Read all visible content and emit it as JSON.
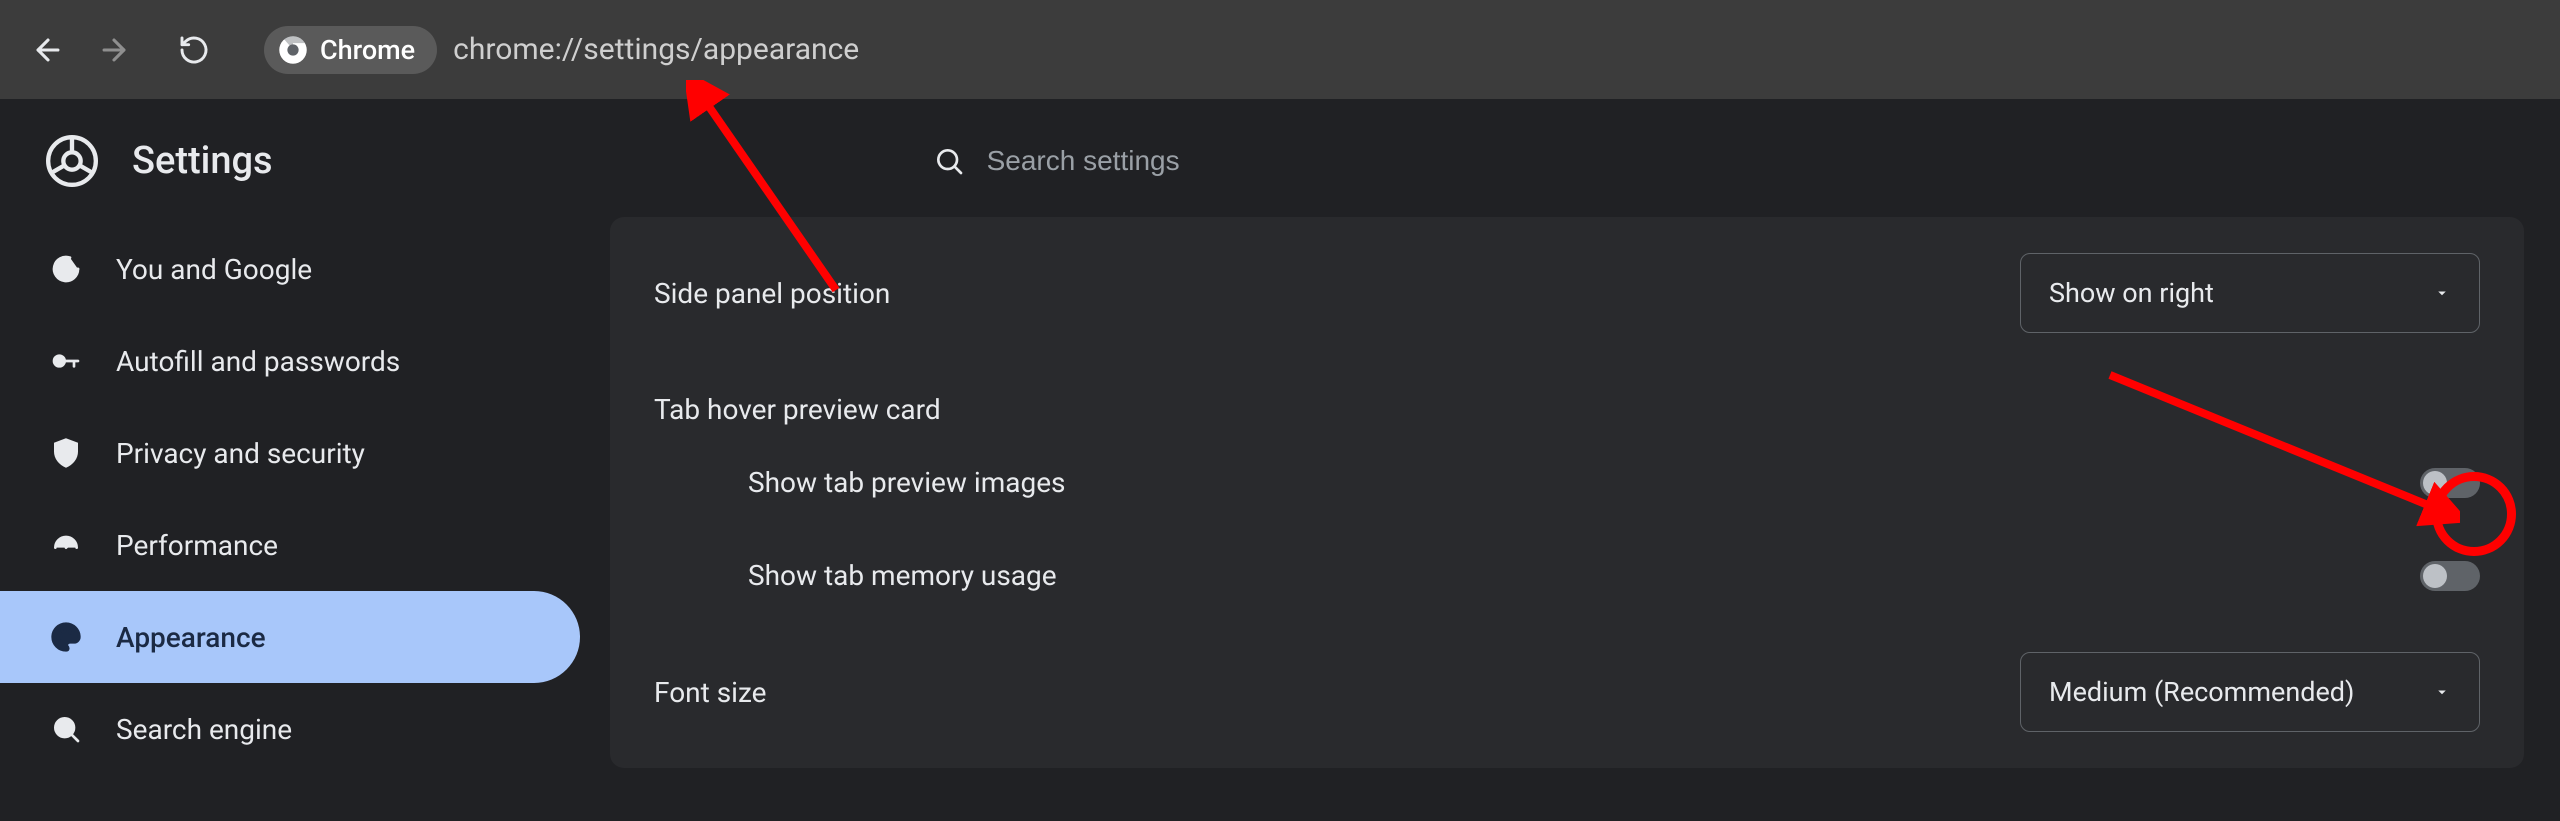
{
  "toolbar": {
    "chrome_chip_label": "Chrome",
    "url": "chrome://settings/appearance"
  },
  "header": {
    "title": "Settings",
    "search_placeholder": "Search settings"
  },
  "sidebar": {
    "items": [
      {
        "icon": "google",
        "label": "You and Google"
      },
      {
        "icon": "key",
        "label": "Autofill and passwords"
      },
      {
        "icon": "shield",
        "label": "Privacy and security"
      },
      {
        "icon": "speedometer",
        "label": "Performance"
      },
      {
        "icon": "palette",
        "label": "Appearance",
        "active": true
      },
      {
        "icon": "search",
        "label": "Search engine"
      }
    ]
  },
  "settings": {
    "side_panel": {
      "label": "Side panel position",
      "value": "Show on right"
    },
    "tab_hover": {
      "label": "Tab hover preview card",
      "preview_images": {
        "label": "Show tab preview images",
        "on": false
      },
      "memory_usage": {
        "label": "Show tab memory usage",
        "on": false
      }
    },
    "font_size": {
      "label": "Font size",
      "value": "Medium (Recommended)"
    }
  }
}
